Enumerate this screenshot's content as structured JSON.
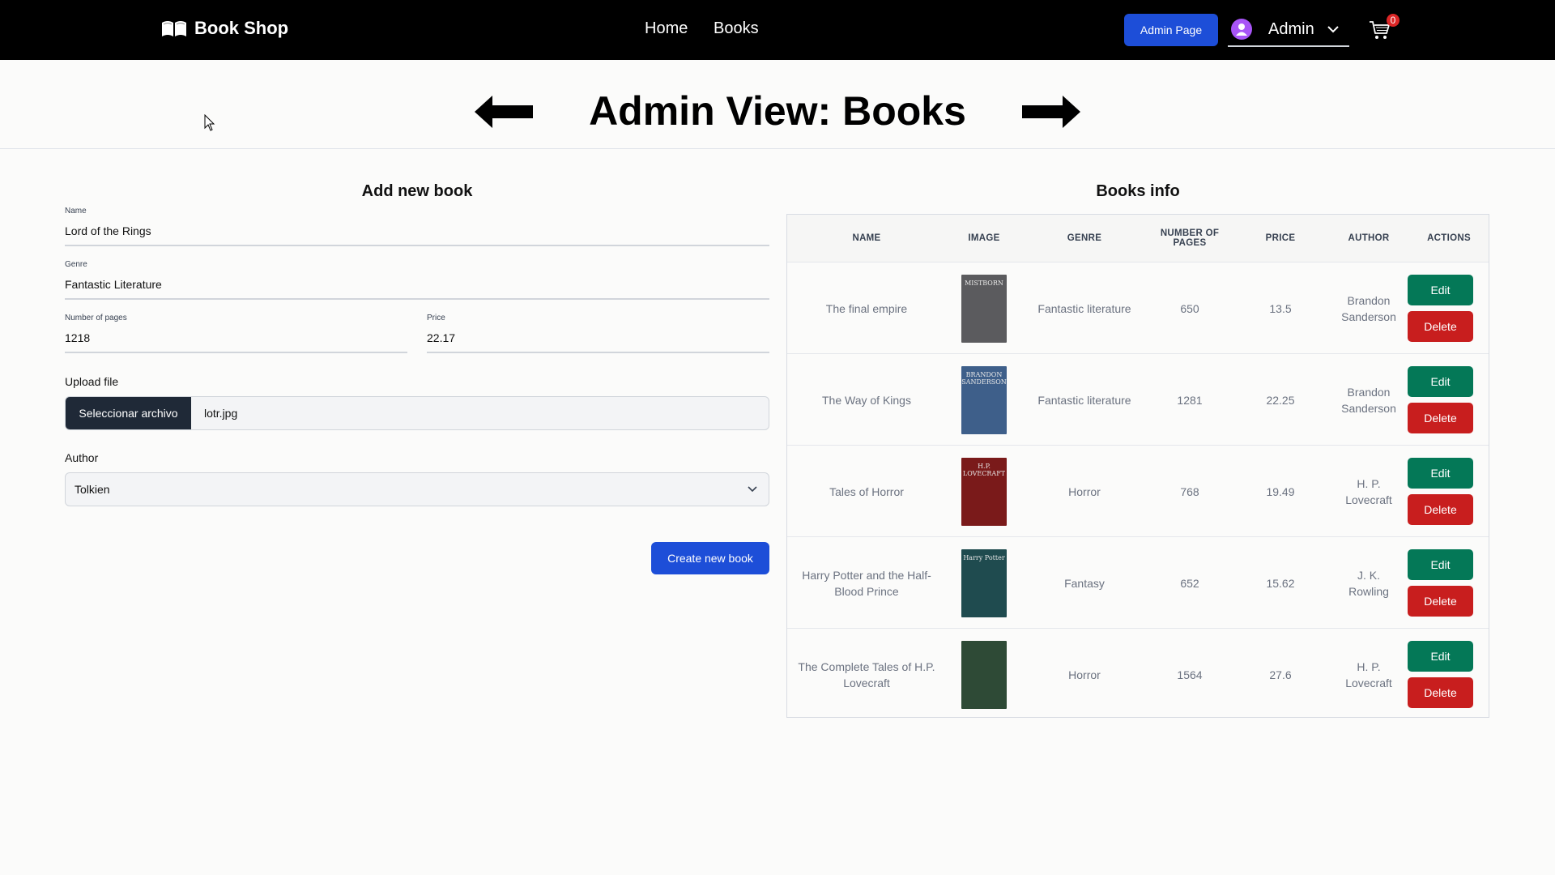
{
  "nav": {
    "brand": "Book Shop",
    "links": [
      "Home",
      "Books"
    ],
    "admin_button": "Admin Page",
    "user_name": "Admin",
    "cart_count": "0"
  },
  "header": {
    "title": "Admin View: Books"
  },
  "form": {
    "title": "Add new book",
    "name_label": "Name",
    "name_value": "Lord of the Rings",
    "genre_label": "Genre",
    "genre_value": "Fantastic Literature",
    "pages_label": "Number of pages",
    "pages_value": "1218",
    "price_label": "Price",
    "price_value": "22.17",
    "upload_label": "Upload file",
    "file_button": "Seleccionar archivo",
    "file_name": "lotr.jpg",
    "author_label": "Author",
    "author_value": "Tolkien",
    "submit": "Create new book"
  },
  "table": {
    "title": "Books info",
    "headers": [
      "NAME",
      "IMAGE",
      "GENRE",
      "NUMBER OF PAGES",
      "PRICE",
      "AUTHOR",
      "ACTIONS"
    ],
    "edit_label": "Edit",
    "delete_label": "Delete",
    "rows": [
      {
        "name": "The final empire",
        "genre": "Fantastic literature",
        "pages": "650",
        "price": "13.5",
        "author": "Brandon Sanderson",
        "cover_color": "#5b5b5e",
        "cover_text": "MISTBORN"
      },
      {
        "name": "The Way of Kings",
        "genre": "Fantastic literature",
        "pages": "1281",
        "price": "22.25",
        "author": "Brandon Sanderson",
        "cover_color": "#3e5f8a",
        "cover_text": "BRANDON SANDERSON"
      },
      {
        "name": "Tales of Horror",
        "genre": "Horror",
        "pages": "768",
        "price": "19.49",
        "author": "H. P. Lovecraft",
        "cover_color": "#7a1a1a",
        "cover_text": "H.P. LOVECRAFT"
      },
      {
        "name": "Harry Potter and the Half-Blood Prince",
        "genre": "Fantasy",
        "pages": "652",
        "price": "15.62",
        "author": "J. K. Rowling",
        "cover_color": "#1f4b4f",
        "cover_text": "Harry Potter"
      },
      {
        "name": "The Complete Tales of H.P. Lovecraft",
        "genre": "Horror",
        "pages": "1564",
        "price": "27.6",
        "author": "H. P. Lovecraft",
        "cover_color": "#2e4a36",
        "cover_text": ""
      }
    ]
  }
}
